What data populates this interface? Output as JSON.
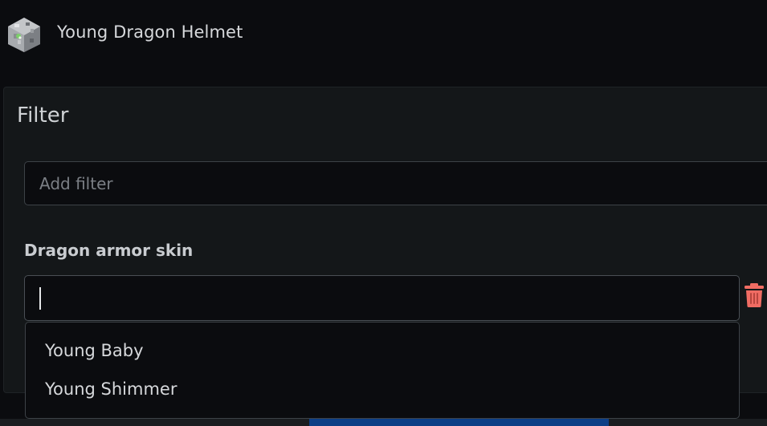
{
  "header": {
    "title": "Young Dragon Helmet",
    "icon": "helmet-icon"
  },
  "filter": {
    "heading": "Filter",
    "add_filter_placeholder": "Add filter",
    "add_filter_value": ""
  },
  "dragon_skin": {
    "label": "Dragon armor skin",
    "value": "",
    "options": [
      "Young Baby",
      "Young Shimmer"
    ],
    "delete_icon": "trash-icon",
    "delete_color": "#f06c63"
  },
  "colors": {
    "background": "#0b0c0f",
    "panel": "#141719",
    "accent_bar": "#0d3f86"
  }
}
